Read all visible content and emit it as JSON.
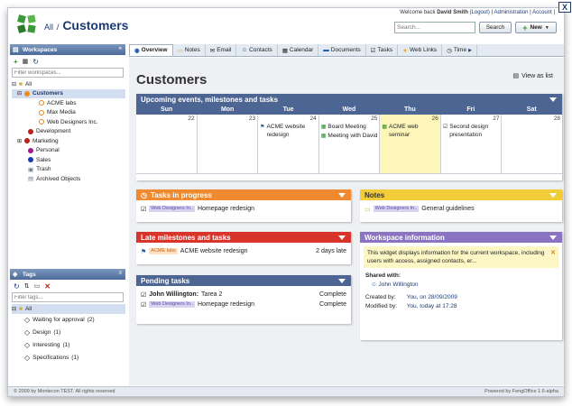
{
  "header": {
    "breadcrumb_root": "All",
    "breadcrumb_sep": "/",
    "breadcrumb_current": "Customers",
    "welcome_prefix": "Welcome back",
    "user_name": "David Smith",
    "logout": "(Logout)",
    "administration": "Administration",
    "account": "Account",
    "separator": "|",
    "search_placeholder": "Search...",
    "search_button": "Search",
    "new_button": "New",
    "close": "X"
  },
  "workspaces": {
    "title": "Workspaces",
    "filter_placeholder": "Filter workspaces...",
    "tree": [
      {
        "label": "All",
        "level": 0
      },
      {
        "label": "Customers",
        "level": 1,
        "selected": true
      },
      {
        "label": "ACME labs",
        "level": 2
      },
      {
        "label": "Max Media",
        "level": 2
      },
      {
        "label": "Web Designers Inc.",
        "level": 2
      },
      {
        "label": "Development",
        "level": 1
      },
      {
        "label": "Marketing",
        "level": 1
      },
      {
        "label": "Personal",
        "level": 1
      },
      {
        "label": "Sales",
        "level": 1
      },
      {
        "label": "Trash",
        "level": 1
      },
      {
        "label": "Archived Objects",
        "level": 1
      }
    ]
  },
  "tags": {
    "title": "Tags",
    "filter_placeholder": "Filter tags...",
    "all": "All",
    "items": [
      {
        "label": "Waiting for approval",
        "count": "(2)"
      },
      {
        "label": "Design",
        "count": "(1)"
      },
      {
        "label": "Interesting",
        "count": "(1)"
      },
      {
        "label": "Specifications",
        "count": "(1)"
      }
    ]
  },
  "tabs": [
    "Overview",
    "Notes",
    "Email",
    "Contacts",
    "Calendar",
    "Documents",
    "Tasks",
    "Web Links",
    "Time"
  ],
  "main": {
    "title": "Customers",
    "view_as_list": "View as list"
  },
  "calendar": {
    "title": "Upcoming events, milestones and tasks",
    "days": [
      "Sun",
      "Mon",
      "Tue",
      "Wed",
      "Thu",
      "Fri",
      "Sat"
    ],
    "cells": [
      {
        "num": "22",
        "events": []
      },
      {
        "num": "23",
        "events": []
      },
      {
        "num": "24",
        "events": [
          "ACME website redesign"
        ]
      },
      {
        "num": "25",
        "events": [
          "Board Meeting",
          "Meeting with David"
        ]
      },
      {
        "num": "26",
        "events": [
          "ACME web seminar"
        ]
      },
      {
        "num": "27",
        "events": [
          "Second design presentation"
        ]
      },
      {
        "num": "28",
        "events": []
      }
    ]
  },
  "tasks_in_progress": {
    "title": "Tasks in progress",
    "rows": [
      {
        "chip": "Web Designers In..",
        "label": "Homepage redesign"
      }
    ]
  },
  "late": {
    "title": "Late milestones and tasks",
    "rows": [
      {
        "chip": "ACME labs",
        "label": "ACME website redesign",
        "status": "2 days late"
      }
    ]
  },
  "pending": {
    "title": "Pending tasks",
    "rows": [
      {
        "name": "John Willington:",
        "task": "Tarea 2",
        "status": "Complete"
      },
      {
        "chip": "Web Designers In..",
        "task": "Homepage redesign",
        "status": "Complete"
      }
    ]
  },
  "notes": {
    "title": "Notes",
    "rows": [
      {
        "chip": "Web Designers In..",
        "label": "General guidelines"
      }
    ]
  },
  "ws_info": {
    "title": "Workspace information",
    "message": "This widget displays information for the current workspace, including users with access, assigned contacts, er...",
    "shared_label": "Shared with:",
    "shared_user": "John Willington",
    "created_label": "Created by:",
    "created_value": "You, on 28/09/2009",
    "modified_label": "Modified by:",
    "modified_value": "You, today at 17:28"
  },
  "footer": {
    "left": "© 2009 by Montecon TEST. All rights reserved",
    "right": "Powered by FengOffice 1.6-alpha"
  },
  "colors": {
    "calendar_header": "#4d6592",
    "tasks_header": "#f08a30",
    "late_header": "#d9342a",
    "pending_header": "#4d6592",
    "notes_header": "#f3cc3a",
    "ws_info_header": "#8a74c2"
  }
}
